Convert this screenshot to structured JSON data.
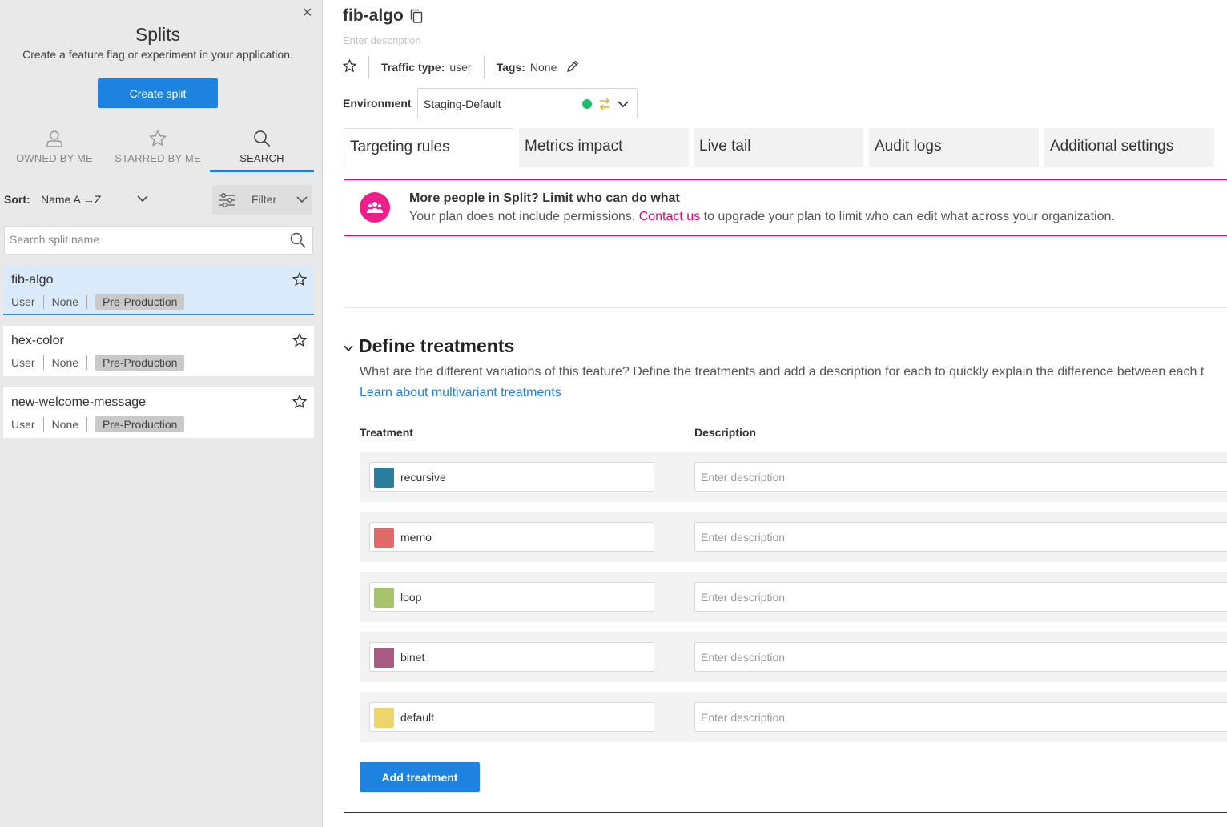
{
  "sidebar": {
    "title": "Splits",
    "subtitle": "Create a feature flag or experiment in your application.",
    "create_button": "Create split",
    "tabs": [
      {
        "label": "OWNED BY ME",
        "icon": "user-icon"
      },
      {
        "label": "STARRED BY ME",
        "icon": "star-icon"
      },
      {
        "label": "SEARCH",
        "icon": "search-icon",
        "active": true
      }
    ],
    "sort_label": "Sort:",
    "sort_value": "Name A →Z",
    "filter_label": "Filter",
    "search_placeholder": "Search split name",
    "splits": [
      {
        "name": "fib-algo",
        "traffic": "User",
        "tags": "None",
        "env_status": "Pre-Production",
        "selected": true
      },
      {
        "name": "hex-color",
        "traffic": "User",
        "tags": "None",
        "env_status": "Pre-Production"
      },
      {
        "name": "new-welcome-message",
        "traffic": "User",
        "tags": "None",
        "env_status": "Pre-Production"
      }
    ]
  },
  "main": {
    "title": "fib-algo",
    "description_placeholder": "Enter description",
    "traffic_type_label": "Traffic type:",
    "traffic_type_value": "user",
    "tags_label": "Tags:",
    "tags_value": "None",
    "environment_label": "Environment",
    "environment_value": "Staging-Default",
    "environment_status_color": "#1dbd6e",
    "tabs": [
      "Targeting rules",
      "Metrics impact",
      "Live tail",
      "Audit logs",
      "Additional settings"
    ],
    "banner": {
      "title": "More people in Split? Limit who can do what",
      "text_before": "Your plan does not include permissions.",
      "link": "Contact us",
      "text_after": "to upgrade your plan to limit who can edit what across your organization."
    },
    "treatments_section": {
      "title": "Define treatments",
      "description": "What are the different variations of this feature? Define the treatments and add a description for each to quickly explain the difference between each t",
      "link": "Learn about multivariant treatments",
      "col_treatment": "Treatment",
      "col_description": "Description",
      "desc_placeholder": "Enter description",
      "treatments": [
        {
          "name": "recursive",
          "color": "#2a7e9c"
        },
        {
          "name": "memo",
          "color": "#e26a6a"
        },
        {
          "name": "loop",
          "color": "#a8c36e"
        },
        {
          "name": "binet",
          "color": "#a85a82"
        },
        {
          "name": "default",
          "color": "#ecd46e"
        }
      ],
      "add_button": "Add treatment"
    }
  }
}
